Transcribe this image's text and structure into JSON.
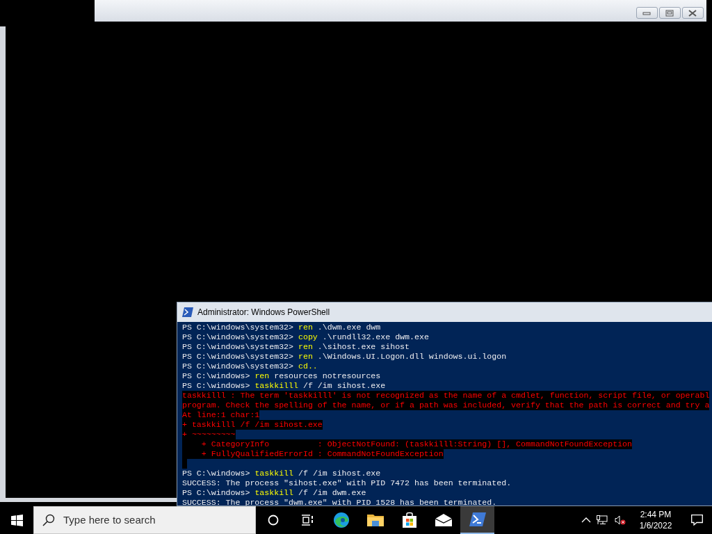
{
  "background_window": {
    "buttons": [
      {
        "kind": "minimize"
      },
      {
        "kind": "maximize"
      },
      {
        "kind": "close"
      }
    ]
  },
  "console": {
    "title": "Administrator: Windows PowerShell",
    "lines": [
      {
        "kind": "command",
        "prompt": "PS C:\\windows\\system32> ",
        "command": "ren",
        "args": " .\\dwm.exe dwm"
      },
      {
        "kind": "command",
        "prompt": "PS C:\\windows\\system32> ",
        "command": "copy",
        "args": " .\\rundll32.exe dwm.exe"
      },
      {
        "kind": "command",
        "prompt": "PS C:\\windows\\system32> ",
        "command": "ren",
        "args": " .\\sihost.exe sihost"
      },
      {
        "kind": "command",
        "prompt": "PS C:\\windows\\system32> ",
        "command": "ren",
        "args": " .\\Windows.UI.Logon.dll windows.ui.logon"
      },
      {
        "kind": "command",
        "prompt": "PS C:\\windows\\system32> ",
        "command": "cd.."
      },
      {
        "kind": "command",
        "prompt": "PS C:\\windows> ",
        "command": "ren",
        "args": " resources notresources"
      },
      {
        "kind": "command",
        "prompt": "PS C:\\windows> ",
        "command": "taskkilll",
        "args": " /f /im sihost.exe"
      },
      {
        "kind": "error",
        "text": "taskkilll : The term 'taskkilll' is not recognized as the name of a cmdlet, function, script file, or operabl"
      },
      {
        "kind": "error",
        "text": "program. Check the spelling of the name, or if a path was included, verify that the path is correct and try a"
      },
      {
        "kind": "error",
        "text": "At line:1 char:1"
      },
      {
        "kind": "error",
        "text": "+ taskkilll /f /im sihost.exe"
      },
      {
        "kind": "error",
        "text": "+ ~~~~~~~~~"
      },
      {
        "kind": "error",
        "text": "    + CategoryInfo          : ObjectNotFound: (taskkilll:String) [], CommandNotFoundException"
      },
      {
        "kind": "error",
        "text": "    + FullyQualifiedErrorId : CommandNotFoundException"
      },
      {
        "kind": "error_gap"
      },
      {
        "kind": "command",
        "prompt": "PS C:\\windows> ",
        "command": "taskkill",
        "args": " /f /im sihost.exe"
      },
      {
        "kind": "output",
        "text": "SUCCESS: The process \"sihost.exe\" with PID 7472 has been terminated."
      },
      {
        "kind": "command",
        "prompt": "PS C:\\windows> ",
        "command": "taskkill",
        "args": " /f /im dwm.exe"
      },
      {
        "kind": "output",
        "text": "SUCCESS: The process \"dwm.exe\" with PID 1528 has been terminated."
      }
    ]
  },
  "taskbar": {
    "search": {
      "placeholder": "Type here to search"
    },
    "apps": [
      {
        "kind": "cortana",
        "selected": false
      },
      {
        "kind": "taskview",
        "selected": false
      },
      {
        "kind": "edge",
        "selected": false
      },
      {
        "kind": "explorer",
        "selected": false
      },
      {
        "kind": "store",
        "selected": false
      },
      {
        "kind": "mail",
        "selected": false
      },
      {
        "kind": "powershell",
        "selected": true
      }
    ],
    "time": "2:44 PM",
    "date": "1/6/2022"
  }
}
